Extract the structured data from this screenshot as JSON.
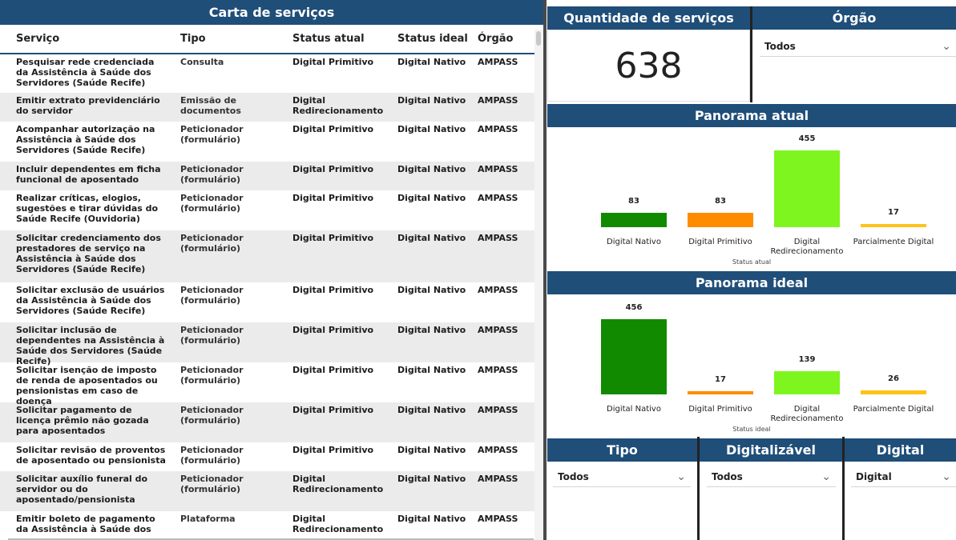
{
  "left": {
    "title": "Carta de serviços",
    "columns": [
      "Serviço",
      "Tipo",
      "Status atual",
      "Status ideal",
      "Órgão"
    ],
    "rows": [
      [
        "Pesquisar rede credenciada da Assistência à Saúde dos Servidores (Saúde Recife)",
        "Consulta",
        "Digital Primitivo",
        "Digital Nativo",
        "AMPASS"
      ],
      [
        "Emitir extrato previdenciário do servidor",
        "Emissão de documentos",
        "Digital Redirecionamento",
        "Digital Nativo",
        "AMPASS"
      ],
      [
        "Acompanhar autorização na Assistência à Saúde dos Servidores (Saúde Recife)",
        "Peticionador (formulário)",
        "Digital Primitivo",
        "Digital Nativo",
        "AMPASS"
      ],
      [
        "Incluir dependentes em ficha funcional de aposentado",
        "Peticionador (formulário)",
        "Digital Primitivo",
        "Digital Nativo",
        "AMPASS"
      ],
      [
        "Realizar críticas, elogios, sugestões e tirar dúvidas do Saúde Recife (Ouvidoria)",
        "Peticionador (formulário)",
        "Digital Primitivo",
        "Digital Nativo",
        "AMPASS"
      ],
      [
        "Solicitar credenciamento dos prestadores de serviço na Assistência à Saúde dos Servidores (Saúde Recife)",
        "Peticionador (formulário)",
        "Digital Primitivo",
        "Digital Nativo",
        "AMPASS"
      ],
      [
        "Solicitar exclusão de usuários da Assistência à Saúde dos Servidores (Saúde Recife)",
        "Peticionador (formulário)",
        "Digital Primitivo",
        "Digital Nativo",
        "AMPASS"
      ],
      [
        "Solicitar inclusão de dependentes na Assistência à Saúde dos Servidores (Saúde Recife)",
        "Peticionador (formulário)",
        "Digital Primitivo",
        "Digital Nativo",
        "AMPASS"
      ],
      [
        "Solicitar isenção de imposto de renda de aposentados ou pensionistas em caso de doença",
        "Peticionador (formulário)",
        "Digital Primitivo",
        "Digital Nativo",
        "AMPASS"
      ],
      [
        "Solicitar pagamento de licença prêmio não gozada para aposentados",
        "Peticionador (formulário)",
        "Digital Primitivo",
        "Digital Nativo",
        "AMPASS"
      ],
      [
        "Solicitar revisão de proventos de aposentado ou pensionista",
        "Peticionador (formulário)",
        "Digital Primitivo",
        "Digital Nativo",
        "AMPASS"
      ],
      [
        "Solicitar auxílio funeral do servidor ou do aposentado/pensionista",
        "Peticionador (formulário)",
        "Digital Redirecionamento",
        "Digital Nativo",
        "AMPASS"
      ],
      [
        "Emitir boleto de pagamento da Assistência à Saúde dos",
        "Plataforma",
        "Digital Redirecionamento",
        "Digital Nativo",
        "AMPASS"
      ]
    ]
  },
  "qty": {
    "title": "Quantidade de serviços",
    "value": "638"
  },
  "orgao": {
    "title": "Órgão",
    "value": "Todos"
  },
  "tipo": {
    "title": "Tipo",
    "value": "Todos"
  },
  "digitalizavel": {
    "title": "Digitalizável",
    "value": "Todos"
  },
  "digital": {
    "title": "Digital",
    "value": "Digital"
  },
  "colors": {
    "dark_green": "#128a00",
    "orange": "#ff8c00",
    "light_green": "#7ff520",
    "yellow": "#ffc21a",
    "header": "#1f4e79"
  },
  "chart_data": [
    {
      "type": "bar",
      "title": "Panorama atual",
      "xlabel": "Status atual",
      "categories": [
        "Digital Nativo",
        "Digital Primitivo",
        "Digital Redirecionamento",
        "Parcialmente Digital"
      ],
      "values": [
        83,
        83,
        455,
        17
      ]
    },
    {
      "type": "bar",
      "title": "Panorama ideal",
      "xlabel": "Status ideal",
      "categories": [
        "Digital Nativo",
        "Digital Primitivo",
        "Digital Redirecionamento",
        "Parcialmente Digital"
      ],
      "values": [
        456,
        17,
        139,
        26
      ]
    }
  ]
}
